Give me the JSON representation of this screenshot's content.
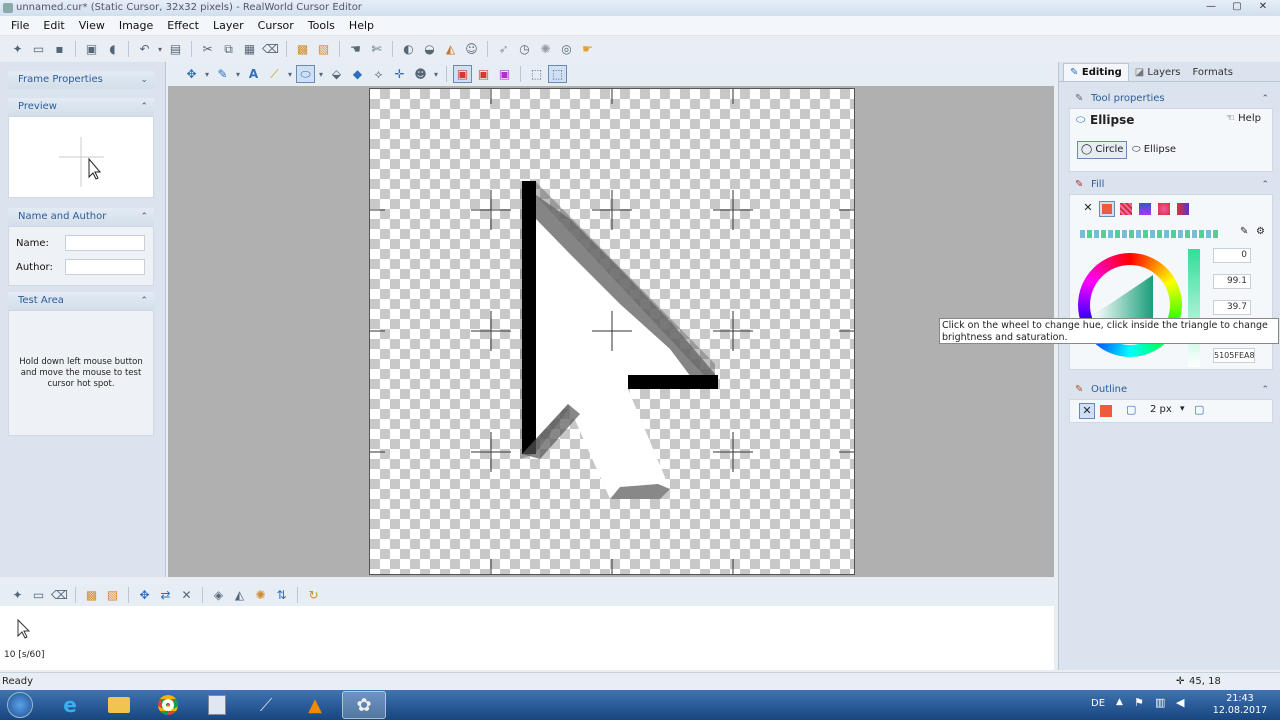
{
  "window": {
    "title": "unnamed.cur* (Static Cursor, 32x32 pixels) - RealWorld Cursor Editor",
    "controls": [
      "—",
      "▢",
      "✕"
    ]
  },
  "menu": [
    "File",
    "Edit",
    "View",
    "Image",
    "Effect",
    "Layer",
    "Cursor",
    "Tools",
    "Help"
  ],
  "left_panel": {
    "frame_properties": "Frame Properties",
    "preview": "Preview",
    "name_author": {
      "title": "Name and Author",
      "name_label": "Name:",
      "author_label": "Author:",
      "name_value": "",
      "author_value": ""
    },
    "test_area": {
      "title": "Test Area",
      "text": "Hold down left mouse button and move the mouse to test cursor hot spot."
    }
  },
  "right_panel": {
    "tabs": [
      "Editing",
      "Layers",
      "Formats"
    ],
    "tool_properties": {
      "title": "Tool properties",
      "tool_name": "Ellipse",
      "help": "Help",
      "options": [
        "Circle",
        "Ellipse"
      ],
      "selected": "Circle"
    },
    "fill": {
      "title": "Fill",
      "values": [
        "0",
        "99.1",
        "39.7"
      ],
      "hex": "5105FEA8"
    },
    "outline": {
      "title": "Outline",
      "width": "2 px"
    }
  },
  "tooltip": "Click on the wheel to change hue, click inside the triangle to change brightness and saturation.",
  "bottom": {
    "frame_label": "10 [s/60]"
  },
  "status": {
    "left": "Ready",
    "coords": "45, 18"
  },
  "tray": {
    "lang": "DE",
    "time": "21:43",
    "date": "12.08.2017"
  },
  "colors": {
    "accent": "#2c5c97",
    "fill_swatch": "#f05a3c",
    "taskbar": "#1f5a9e"
  }
}
